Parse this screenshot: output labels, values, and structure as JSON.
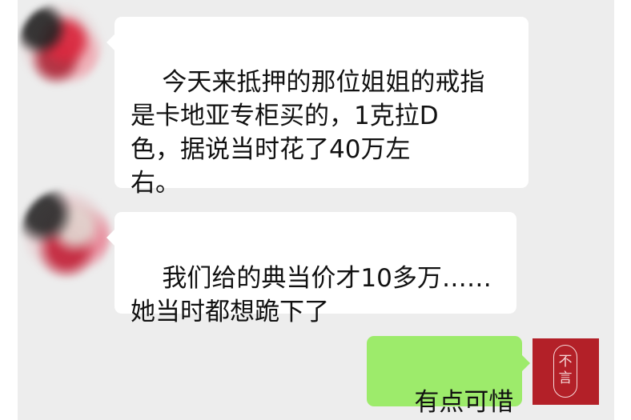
{
  "messages": [
    {
      "side": "left",
      "text": "今天来抵押的那位姐姐的戒指\n是卡地亚专柜买的，1克拉D\n色，据说当时花了40万左\n右。"
    },
    {
      "side": "left",
      "text": "我们给的典当价才10多万……\n她当时都想跪下了"
    },
    {
      "side": "right",
      "text": "有点可惜"
    }
  ],
  "self_avatar": {
    "char_top": "不",
    "char_bottom": "言",
    "background_color": "#b32028"
  },
  "colors": {
    "chat_background": "#ededed",
    "incoming_bubble": "#ffffff",
    "outgoing_bubble": "#9deb6b"
  }
}
